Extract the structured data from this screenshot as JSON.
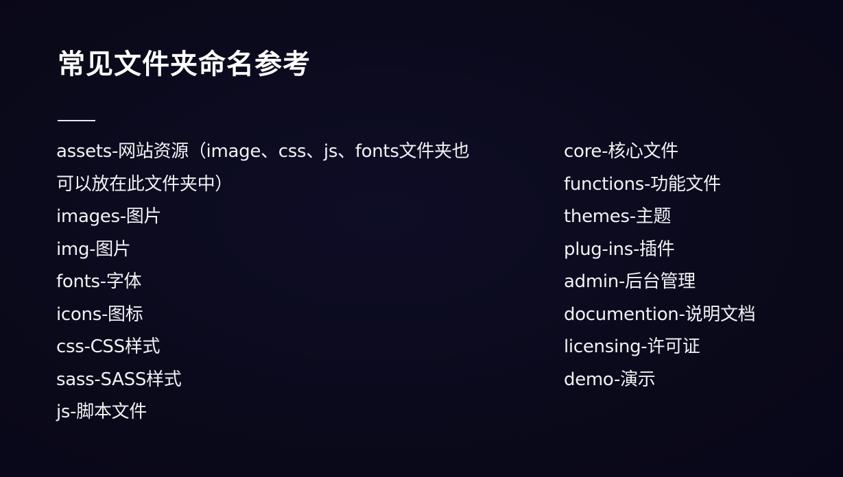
{
  "slide": {
    "title": "常见文件夹命名参考",
    "left_items": [
      "assets-网站资源（image、css、js、fonts文件夹也",
      "可以放在此文件夹中）",
      "images-图片",
      "img-图片",
      "fonts-字体",
      "icons-图标",
      "css-CSS样式",
      "sass-SASS样式",
      "js-脚本文件"
    ],
    "right_items": [
      "core-核心文件",
      "functions-功能文件",
      "themes-主题",
      "plug-ins-插件",
      "admin-后台管理",
      "documention-说明文档",
      "licensing-许可证",
      "demo-演示"
    ]
  },
  "colors": {
    "background": "#0b0a1e",
    "text": "#f4f4f7"
  }
}
